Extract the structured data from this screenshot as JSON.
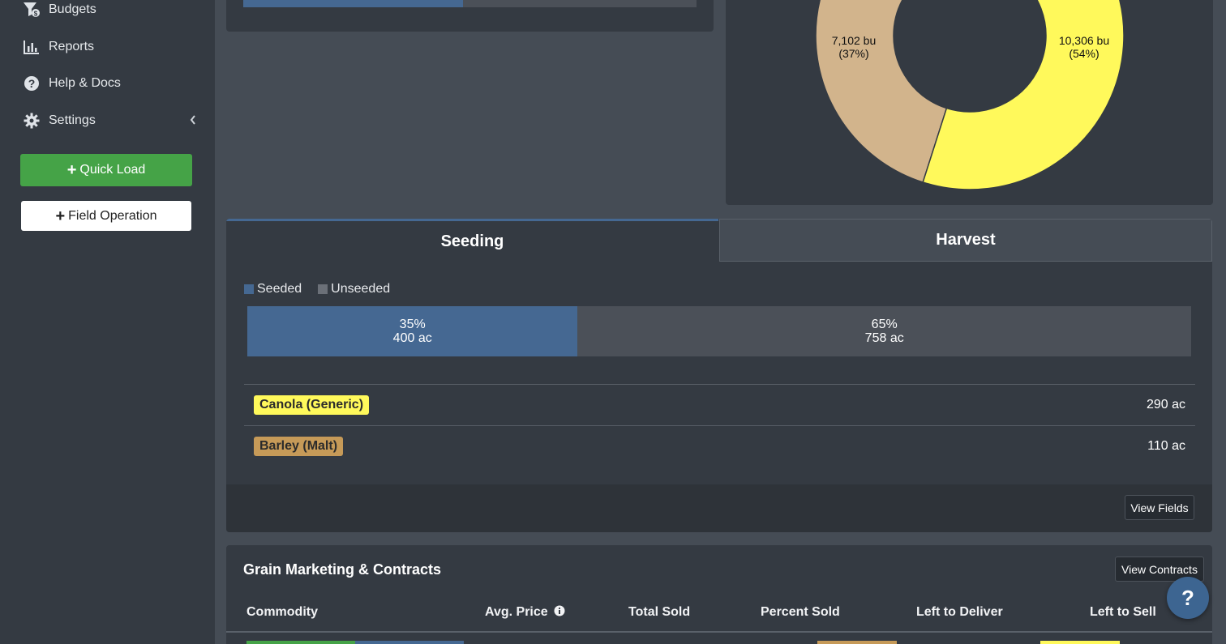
{
  "sidebar": {
    "items": [
      {
        "label": "Budgets",
        "icon": "budget-filter-icon"
      },
      {
        "label": "Reports",
        "icon": "bar-chart-icon"
      },
      {
        "label": "Help & Docs",
        "icon": "question-circle-icon"
      },
      {
        "label": "Settings",
        "icon": "gear-icon"
      }
    ],
    "quick_load_label": "Quick Load",
    "field_operation_label": "Field Operation"
  },
  "top_progress": {
    "fraction": 0.485,
    "fill_color": "#456892"
  },
  "donut": {
    "slices": [
      {
        "label_value": "7,102 bu",
        "label_pct": "(37%)",
        "color": "#d2b48c"
      },
      {
        "label_value": "10,306 bu",
        "label_pct": "(54%)",
        "color": "#fff95b"
      }
    ]
  },
  "seeding": {
    "tabs": {
      "seeding": "Seeding",
      "harvest": "Harvest"
    },
    "legend": {
      "seeded": "Seeded",
      "unseeded": "Unseeded",
      "seeded_color": "#456892",
      "unseeded_color": "#6b7078"
    },
    "seeded_pct": "35%",
    "seeded_ac": "400 ac",
    "unseeded_pct": "65%",
    "unseeded_ac": "758 ac",
    "seeded_fraction": 0.35,
    "crops": [
      {
        "name": "Canola (Generic)",
        "value": "290 ac",
        "color": "#fff95b"
      },
      {
        "name": "Barley (Malt)",
        "value": "110 ac",
        "color": "#c69a58"
      }
    ],
    "view_fields_label": "View Fields"
  },
  "grain": {
    "title": "Grain Marketing & Contracts",
    "view_contracts_label": "View Contracts",
    "columns": [
      "Commodity",
      "Avg. Price",
      "Total Sold",
      "Percent Sold",
      "Left to Deliver",
      "Left to Sell"
    ]
  },
  "help_fab_label": "?"
}
